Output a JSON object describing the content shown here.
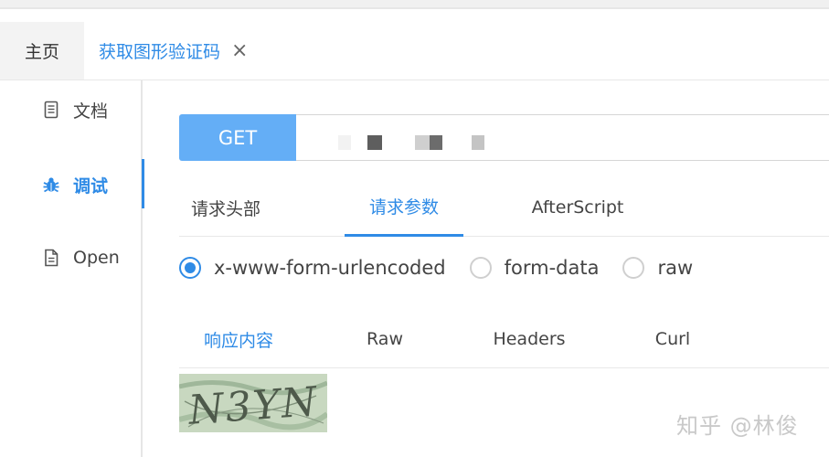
{
  "tabs": {
    "home_label": "主页",
    "active_label": "获取图形验证码",
    "close_glyph": "×"
  },
  "sidebar": {
    "items": [
      {
        "label": "文档",
        "icon": "document-icon"
      },
      {
        "label": "调试",
        "icon": "bug-icon"
      },
      {
        "label": "Open",
        "icon": "file-icon"
      }
    ]
  },
  "request": {
    "method": "GET",
    "url": ""
  },
  "request_tabs": [
    {
      "label": "请求头部",
      "active": false
    },
    {
      "label": "请求参数",
      "active": true
    },
    {
      "label": "AfterScript",
      "active": false
    }
  ],
  "body_types": [
    {
      "label": "x-www-form-urlencoded",
      "checked": true
    },
    {
      "label": "form-data",
      "checked": false
    },
    {
      "label": "raw",
      "checked": false
    }
  ],
  "response_tabs": [
    {
      "label": "响应内容",
      "active": true
    },
    {
      "label": "Raw",
      "active": false
    },
    {
      "label": "Headers",
      "active": false
    },
    {
      "label": "Curl",
      "active": false
    }
  ],
  "captcha": {
    "text": "N3YN"
  },
  "watermark": "知乎 @林俊",
  "colors": {
    "accent": "#2f8be6",
    "method_button": "#64aef6"
  }
}
